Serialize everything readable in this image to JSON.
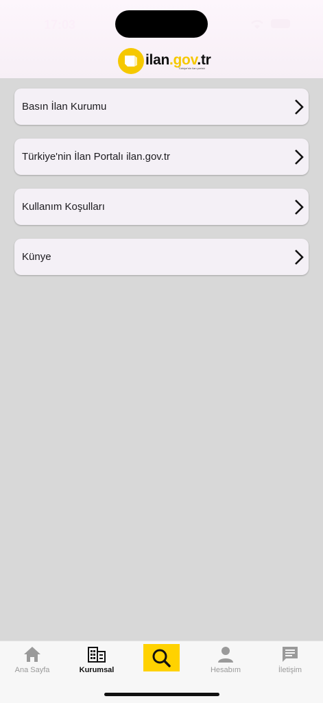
{
  "status_bar": {
    "time": "17:03"
  },
  "header": {
    "logo_text": "ilan",
    "logo_domain": ".gov",
    "logo_tld": ".tr",
    "logo_tagline": "Türkiye'nin ilan portalı"
  },
  "menu": {
    "items": [
      {
        "label": "Basın İlan Kurumu"
      },
      {
        "label": "Türkiye'nin İlan Portalı ilan.gov.tr"
      },
      {
        "label": "Kullanım Koşulları"
      },
      {
        "label": "Künye"
      }
    ]
  },
  "bottom_nav": {
    "items": [
      {
        "label": "Ana Sayfa",
        "icon": "home-icon"
      },
      {
        "label": "Kurumsal",
        "icon": "building-icon",
        "active": true
      },
      {
        "label": "",
        "icon": "search-icon"
      },
      {
        "label": "Hesabım",
        "icon": "person-icon"
      },
      {
        "label": "İletişim",
        "icon": "chat-icon"
      }
    ]
  },
  "colors": {
    "brand_yellow": "#f5c800",
    "search_yellow": "#ffd200",
    "background": "#d8d8d8",
    "card": "#f4f0f6"
  }
}
